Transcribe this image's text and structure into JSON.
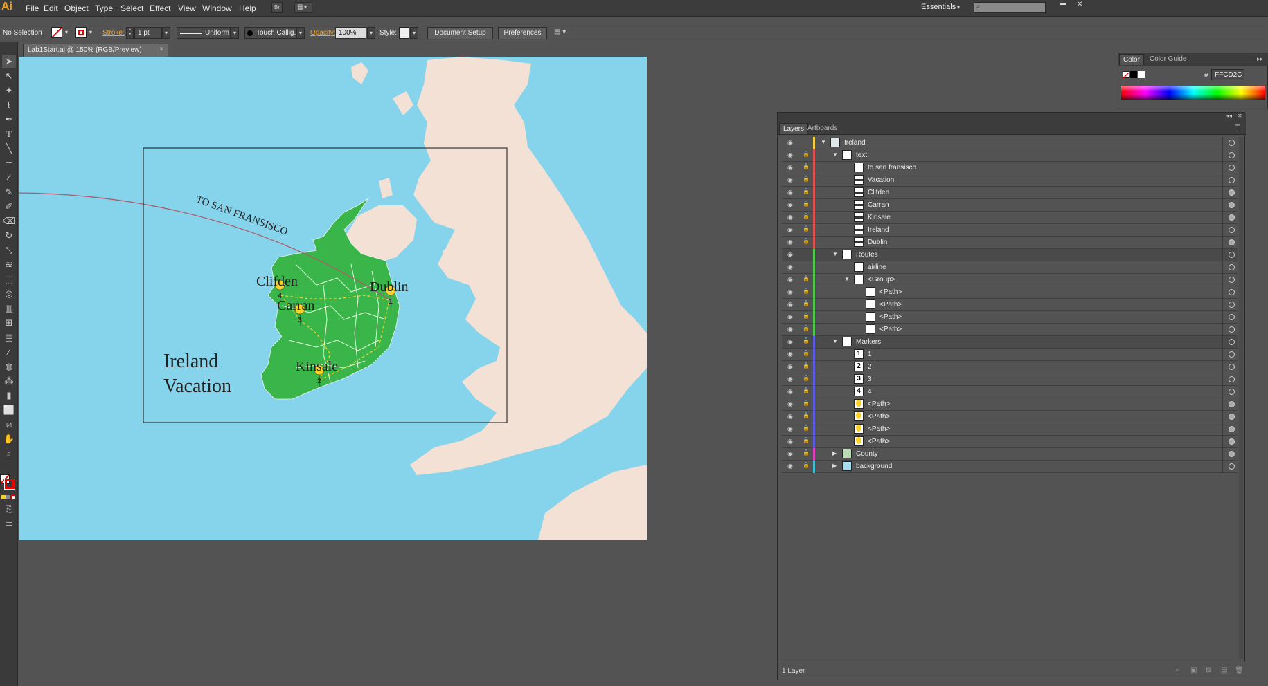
{
  "app": {
    "logo": "Ai"
  },
  "menus": [
    "File",
    "Edit",
    "Object",
    "Type",
    "Select",
    "Effect",
    "View",
    "Window",
    "Help"
  ],
  "menubar": {
    "bridge": "Br",
    "workspace": "Essentials",
    "search_placeholder": ""
  },
  "controlbar": {
    "selection": "No Selection",
    "stroke_label": "Stroke:",
    "stroke_weight": "1 pt",
    "profile": "Uniform",
    "brush": "Touch Callig...",
    "opacity_label": "Opacity:",
    "opacity": "100%",
    "style_label": "Style:",
    "document_setup": "Document Setup",
    "preferences": "Preferences"
  },
  "document_tab": {
    "title": "Lab1Start.ai @ 150% (RGB/Preview)",
    "close": "×"
  },
  "map": {
    "route_label": "TO SAN FRANSISCO",
    "title_line1": "Ireland",
    "title_line2": "Vacation",
    "cities": [
      {
        "name": "Clifden",
        "marker": "4"
      },
      {
        "name": "Carran",
        "marker": "3"
      },
      {
        "name": "Dublin",
        "marker": "1"
      },
      {
        "name": "Kinsale",
        "marker": "2"
      }
    ],
    "colors": {
      "sea": "#86d4ec",
      "land": "#f4e1d6",
      "ireland": "#39b54a",
      "marker": "#f7d12c",
      "route": "#b05a6a"
    }
  },
  "color_panel": {
    "tabs": [
      "Color",
      "Color Guide"
    ],
    "hex_label": "#",
    "hex": "FFCD2C"
  },
  "layers_panel": {
    "tabs": [
      "Layers",
      "Artboards"
    ],
    "footer": "1 Layer",
    "rows": [
      {
        "name": "Ireland",
        "depth": 0,
        "open": true,
        "bar": "#f2d03a",
        "lock": false,
        "thumb": "ireland",
        "filled": false,
        "dark": false
      },
      {
        "name": "text",
        "depth": 1,
        "open": true,
        "bar": "#e05050",
        "lock": true,
        "thumb": "blank",
        "filled": false,
        "dark": false
      },
      {
        "name": "to san fransisco",
        "depth": 2,
        "bar": "#e05050",
        "lock": true,
        "thumb": "blank",
        "filled": false,
        "dark": false
      },
      {
        "name": "Vacation",
        "depth": 2,
        "bar": "#e05050",
        "lock": true,
        "thumb": "text",
        "filled": false,
        "dark": false
      },
      {
        "name": "Clifden",
        "depth": 2,
        "bar": "#e05050",
        "lock": true,
        "thumb": "text",
        "filled": true,
        "dark": false
      },
      {
        "name": "Carran",
        "depth": 2,
        "bar": "#e05050",
        "lock": true,
        "thumb": "text",
        "filled": true,
        "dark": false
      },
      {
        "name": "Kinsale",
        "depth": 2,
        "bar": "#e05050",
        "lock": true,
        "thumb": "text",
        "filled": true,
        "dark": false
      },
      {
        "name": "Ireland",
        "depth": 2,
        "bar": "#e05050",
        "lock": true,
        "thumb": "text",
        "filled": false,
        "dark": false
      },
      {
        "name": "Dublin",
        "depth": 2,
        "bar": "#e05050",
        "lock": true,
        "thumb": "text",
        "filled": true,
        "dark": false
      },
      {
        "name": "Routes",
        "depth": 1,
        "open": true,
        "bar": "#4cc84c",
        "lock": false,
        "thumb": "blank",
        "filled": false,
        "dark": true
      },
      {
        "name": "airline",
        "depth": 2,
        "bar": "#4cc84c",
        "lock": false,
        "thumb": "blank",
        "filled": false,
        "dark": false
      },
      {
        "name": "<Group>",
        "depth": 2,
        "open": true,
        "bar": "#4cc84c",
        "lock": true,
        "thumb": "blank",
        "filled": false,
        "dark": false
      },
      {
        "name": "<Path>",
        "depth": 3,
        "bar": "#4cc84c",
        "lock": true,
        "thumb": "blank",
        "filled": false,
        "dark": false
      },
      {
        "name": "<Path>",
        "depth": 3,
        "bar": "#4cc84c",
        "lock": true,
        "thumb": "blank",
        "filled": false,
        "dark": false
      },
      {
        "name": "<Path>",
        "depth": 3,
        "bar": "#4cc84c",
        "lock": true,
        "thumb": "blank",
        "filled": false,
        "dark": false
      },
      {
        "name": "<Path>",
        "depth": 3,
        "bar": "#4cc84c",
        "lock": true,
        "thumb": "blank",
        "filled": false,
        "dark": false
      },
      {
        "name": "Markers",
        "depth": 1,
        "open": true,
        "bar": "#5a5ae0",
        "lock": true,
        "thumb": "blank",
        "filled": false,
        "dark": true
      },
      {
        "name": "1",
        "depth": 2,
        "bar": "#5a5ae0",
        "lock": true,
        "thumb": "1",
        "filled": false,
        "dark": false
      },
      {
        "name": "2",
        "depth": 2,
        "bar": "#5a5ae0",
        "lock": true,
        "thumb": "2",
        "filled": false,
        "dark": false
      },
      {
        "name": "3",
        "depth": 2,
        "bar": "#5a5ae0",
        "lock": true,
        "thumb": "3",
        "filled": false,
        "dark": false
      },
      {
        "name": "4",
        "depth": 2,
        "bar": "#5a5ae0",
        "lock": true,
        "thumb": "4",
        "filled": false,
        "dark": false
      },
      {
        "name": "<Path>",
        "depth": 2,
        "bar": "#5a5ae0",
        "lock": true,
        "thumb": "marker",
        "filled": true,
        "dark": false
      },
      {
        "name": "<Path>",
        "depth": 2,
        "bar": "#5a5ae0",
        "lock": true,
        "thumb": "marker",
        "filled": true,
        "dark": false
      },
      {
        "name": "<Path>",
        "depth": 2,
        "bar": "#5a5ae0",
        "lock": true,
        "thumb": "marker",
        "filled": true,
        "dark": false
      },
      {
        "name": "<Path>",
        "depth": 2,
        "bar": "#5a5ae0",
        "lock": true,
        "thumb": "marker",
        "filled": true,
        "dark": false
      },
      {
        "name": "County",
        "depth": 1,
        "open": false,
        "bar": "#e040c0",
        "lock": true,
        "thumb": "county",
        "filled": true,
        "dark": false
      },
      {
        "name": "background",
        "depth": 1,
        "open": false,
        "bar": "#40c0d0",
        "lock": true,
        "thumb": "bg",
        "filled": false,
        "dark": false
      }
    ]
  }
}
